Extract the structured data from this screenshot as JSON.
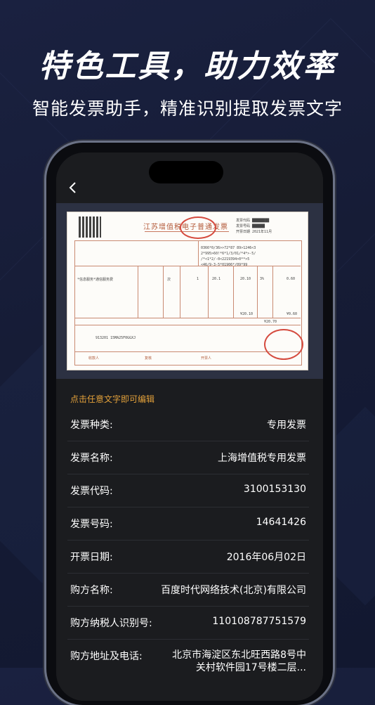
{
  "headline": "特色工具，助力效率",
  "subline": "智能发票助手，精准识别提取发票文字",
  "app": {
    "back_icon": "chevron-left-icon",
    "hint": "点击任意文字即可编辑",
    "fields": [
      {
        "label": "发票种类:",
        "value": "专用发票"
      },
      {
        "label": "发票名称:",
        "value": "上海增值税专用发票"
      },
      {
        "label": "发票代码:",
        "value": "3100153130"
      },
      {
        "label": "发票号码:",
        "value": "14641426"
      },
      {
        "label": "开票日期:",
        "value": "2016年06月02日"
      },
      {
        "label": "购方名称:",
        "value": "百度时代网络技术(北京)有限公司"
      },
      {
        "label": "购方纳税人识别号:",
        "value": "110108787751579"
      },
      {
        "label": "购方地址及电话:",
        "value": "北京市海淀区东北旺西路8号中关村软件园17号楼二层..."
      }
    ]
  },
  "invoice_image": {
    "title": "江苏增值税电子普通发票",
    "codes": "0366*0/36>>72*87 89>1246<3",
    "line_item": "*信息服务*通信服务费",
    "unit": "次",
    "qty": "1",
    "price": "20.1",
    "amount": "20.10",
    "tax_rate": "3%",
    "tax": "0.60",
    "total_amount": "¥20.10",
    "total_tax": "¥0.60",
    "total_small": "¥20.70",
    "seller_tax_id": "913201 15MA25F0GGXJ",
    "remark": "开票人",
    "reviewer": "复核",
    "payee": "收款人"
  },
  "colors": {
    "accent": "#e2a03a",
    "panel": "#1b1c1f",
    "background": "#161c36"
  }
}
